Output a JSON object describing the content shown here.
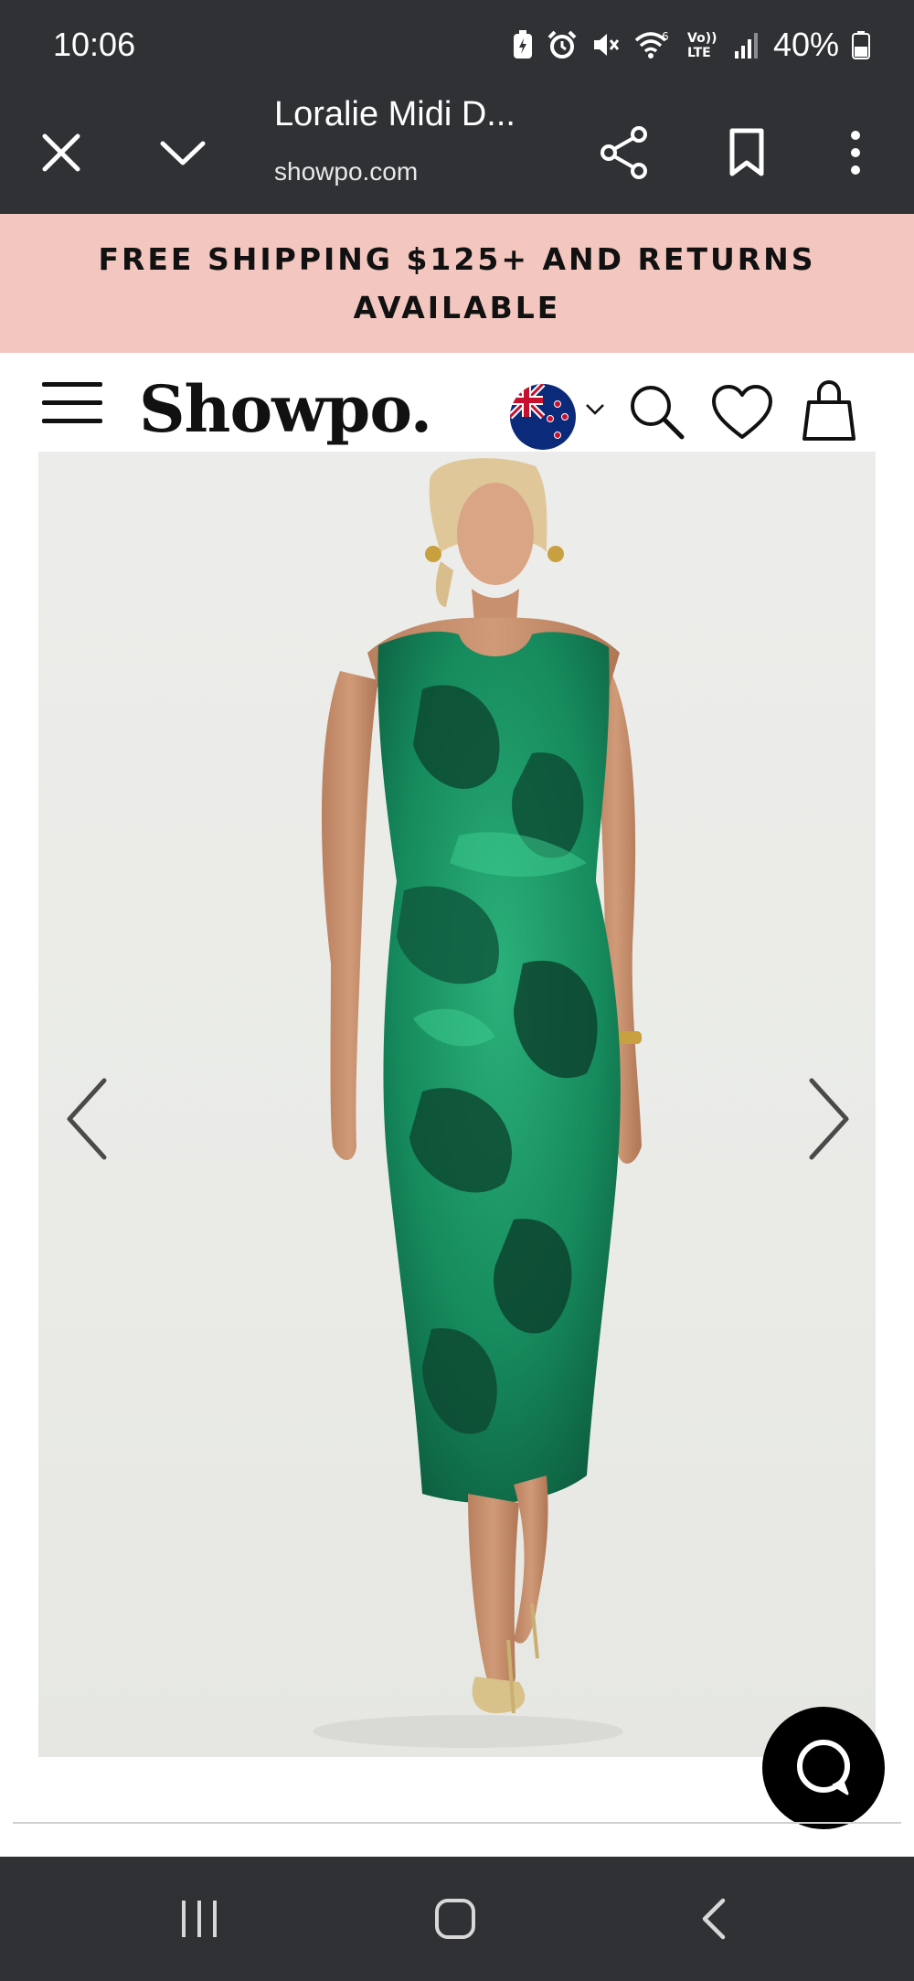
{
  "status_bar": {
    "time": "10:06",
    "battery": "40%",
    "icons": [
      "battery-saver-icon",
      "alarm-icon",
      "mute-icon",
      "wifi-6-icon",
      "volte-icon",
      "signal-icon",
      "battery-icon"
    ]
  },
  "browser": {
    "page_title": "Loralie Midi D...",
    "url": "showpo.com",
    "actions": [
      "close-icon",
      "chevron-down-icon",
      "share-icon",
      "bookmark-icon",
      "more-vert-icon"
    ]
  },
  "promo": {
    "text": "FREE SHIPPING $125+ AND RETURNS AVAILABLE",
    "background": "#f3c7c0"
  },
  "site_header": {
    "logo": "Showpo.",
    "icons": [
      "menu-icon",
      "nz-flag-icon",
      "chevron-down-icon",
      "search-icon",
      "heart-icon",
      "bag-icon"
    ]
  },
  "product": {
    "dress_color": "#1e8c5f"
  },
  "colors": {
    "chrome": "#2f3135",
    "chat_button": "#000000"
  }
}
